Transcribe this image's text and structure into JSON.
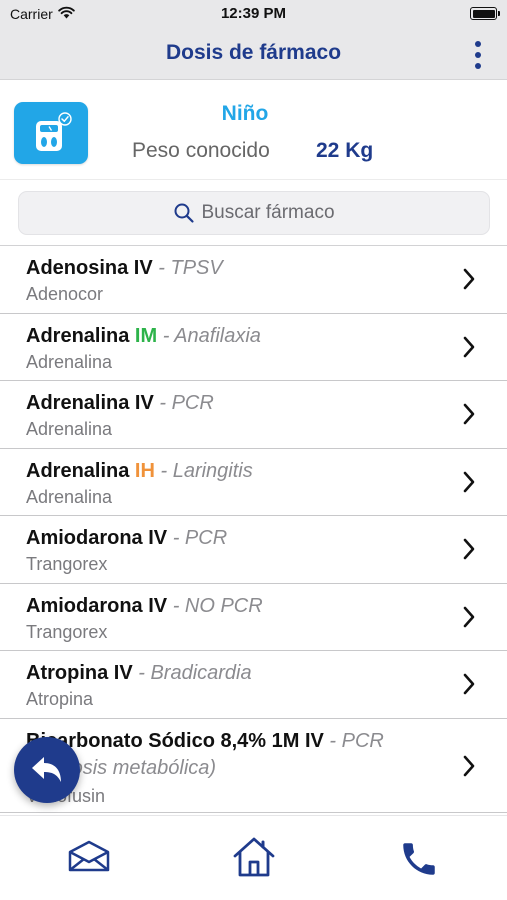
{
  "status_bar": {
    "carrier": "Carrier",
    "time": "12:39 PM",
    "battery_level": 1.0
  },
  "nav": {
    "title": "Dosis de fármaco",
    "menu_icon": "more-vertical-icon"
  },
  "patient": {
    "type": "Niño",
    "weight_label": "Peso conocido",
    "weight_value": "22 Kg",
    "scale_icon": "weight-scale-icon"
  },
  "search": {
    "placeholder": "Buscar fármaco",
    "icon": "search-icon"
  },
  "drugs": [
    {
      "name": "Adenosina IV",
      "route": "",
      "indication": " - TPSV",
      "brand": "Adenocor"
    },
    {
      "name": "Adrenalina ",
      "route": "IM",
      "route_color": "#2db34a",
      "indication": " - Anafilaxia",
      "brand": "Adrenalina"
    },
    {
      "name": "Adrenalina IV",
      "route": "",
      "indication": " - PCR",
      "brand": "Adrenalina"
    },
    {
      "name": "Adrenalina ",
      "route": "IH",
      "route_color": "#f0923a",
      "indication": " - Laringitis",
      "brand": "Adrenalina"
    },
    {
      "name": "Amiodarona IV",
      "route": "",
      "indication": " - PCR",
      "brand": "Trangorex"
    },
    {
      "name": "Amiodarona IV",
      "route": "",
      "indication": " - NO PCR",
      "brand": "Trangorex"
    },
    {
      "name": "Atropina IV",
      "route": "",
      "indication": " - Bradicardia",
      "brand": "Atropina"
    },
    {
      "name": "Bicarbonato Sódico 8,4% 1M IV",
      "route": "",
      "indication": " - PCR",
      "indication_cont": "(Acidosis metabólica)",
      "brand": "Venofusin"
    }
  ],
  "fab": {
    "icon": "undo-arrow-icon"
  },
  "tab_bar": {
    "items": [
      {
        "icon": "mail-icon"
      },
      {
        "icon": "home-icon"
      },
      {
        "icon": "phone-icon"
      }
    ]
  },
  "colors": {
    "primary": "#1f3b8c",
    "accent": "#22a6e7",
    "green": "#2db34a",
    "orange": "#f0923a"
  }
}
